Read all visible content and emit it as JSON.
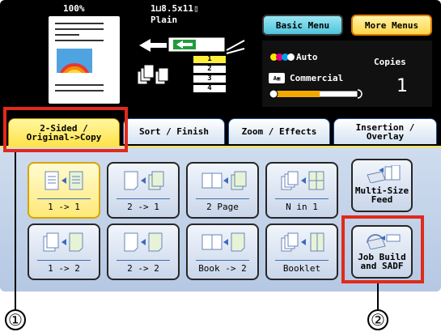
{
  "status": {
    "zoom": "100%",
    "paper_size": "1⊔8.5x11▯",
    "paper_type": "Plain",
    "trays": [
      "1",
      "2",
      "3",
      "4"
    ],
    "selected_tray": "1"
  },
  "menus": {
    "basic_label": "Basic Menu",
    "more_label": "More Menus"
  },
  "settings": {
    "color_mode": "Auto",
    "copies_label": "Copies",
    "quality": "Commercial",
    "copies_count": "1",
    "density_level": 0.55
  },
  "tabs": [
    {
      "label_line1": "2-Sided /",
      "label_line2": "Original->Copy",
      "active": true
    },
    {
      "label_line1": "Sort / Finish",
      "label_line2": "",
      "active": false
    },
    {
      "label_line1": "Zoom / Effects",
      "label_line2": "",
      "active": false
    },
    {
      "label_line1": "Insertion /",
      "label_line2": "Overlay",
      "active": false
    }
  ],
  "options_row1": [
    {
      "label": "1 -> 1",
      "selected": true
    },
    {
      "label": "2 -> 1",
      "selected": false
    },
    {
      "label": "2 Page",
      "selected": false
    },
    {
      "label": "N in 1",
      "selected": false
    }
  ],
  "options_row2": [
    {
      "label": "1 -> 2",
      "selected": false
    },
    {
      "label": "2 -> 2",
      "selected": false
    },
    {
      "label": "Book -> 2",
      "selected": false
    },
    {
      "label": "Booklet",
      "selected": false
    }
  ],
  "side_buttons": {
    "multi_size_line1": "Multi-Size",
    "multi_size_line2": "Feed",
    "job_build_line1": "Job Build",
    "job_build_line2": "and SADF"
  },
  "callouts": {
    "one": "①",
    "two": "②"
  },
  "colors": {
    "highlight": "#e02a1b",
    "active_tab": "#ffe34a",
    "basic_menu": "#4fc4dc",
    "more_menu": "#ffd64a"
  }
}
